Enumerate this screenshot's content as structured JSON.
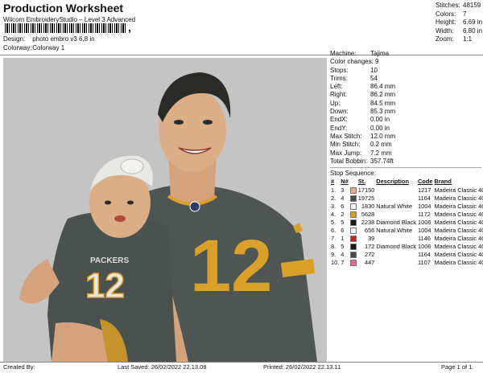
{
  "header": {
    "title": "Production Worksheet",
    "subtitle": "Wilcom EmbroideryStudio – Level 3 Advanced",
    "design_label": "Design:",
    "design_value": "photo embro v3 6,8 in",
    "colorway_label": "Colorway:",
    "colorway_value": "Colorway 1"
  },
  "stats": [
    {
      "label": "Stitches:",
      "value": "48159"
    },
    {
      "label": "Colors:",
      "value": "7"
    },
    {
      "label": "Height:",
      "value": "6.69 in"
    },
    {
      "label": "Width:",
      "value": "6.80 in"
    },
    {
      "label": "Zoom:",
      "value": "1:1"
    }
  ],
  "machine_info": [
    {
      "label": "Machine:",
      "value": "Tajima"
    },
    {
      "label": "Color changes:",
      "value": "9"
    },
    {
      "label": "Stops:",
      "value": "10"
    },
    {
      "label": "Trims:",
      "value": "54"
    },
    {
      "label": "Left:",
      "value": "86.4 mm"
    },
    {
      "label": "Right:",
      "value": "86.2 mm"
    },
    {
      "label": "Up:",
      "value": "84.5 mm"
    },
    {
      "label": "Down:",
      "value": "85.3 mm"
    },
    {
      "label": "EndX:",
      "value": "0.00 in"
    },
    {
      "label": "EndY:",
      "value": "0.00 in"
    },
    {
      "label": "Max Stitch:",
      "value": "12.0 mm"
    },
    {
      "label": "Min Stitch:",
      "value": "0.2 mm"
    },
    {
      "label": "Max Jump:",
      "value": "7.2 mm"
    },
    {
      "label": "Total Bobbin:",
      "value": "357.74ft"
    }
  ],
  "stop_sequence": {
    "title": "Stop Sequence:",
    "headers": [
      "#",
      "N#",
      "",
      "St.",
      "Description",
      "Code",
      "Brand"
    ],
    "rows": [
      {
        "num": "1.",
        "n": "3",
        "color": "#e8a98e",
        "st": "17150",
        "desc": "",
        "code": "1217",
        "brand": "Madeira Classic 40"
      },
      {
        "num": "2.",
        "n": "4",
        "color": "#4a4a4a",
        "st": "19725",
        "desc": "",
        "code": "1164",
        "brand": "Madeira Classic 40"
      },
      {
        "num": "3.",
        "n": "6",
        "color": "#f4f4f4",
        "st": "1830",
        "desc": "Natural White",
        "code": "1004",
        "brand": "Madeira Classic 40"
      },
      {
        "num": "4.",
        "n": "2",
        "color": "#d9a02a",
        "st": "5628",
        "desc": "",
        "code": "1172",
        "brand": "Madeira Classic 40"
      },
      {
        "num": "5.",
        "n": "5",
        "color": "#1a1a1a",
        "st": "2238",
        "desc": "Diamond Black",
        "code": "1006",
        "brand": "Madeira Classic 40"
      },
      {
        "num": "6.",
        "n": "6",
        "color": "#f4f4f4",
        "st": "656",
        "desc": "Natural White",
        "code": "1004",
        "brand": "Madeira Classic 40"
      },
      {
        "num": "7.",
        "n": "1",
        "color": "#c81e1e",
        "st": "39",
        "desc": "",
        "code": "1146",
        "brand": "Madeira Classic 40"
      },
      {
        "num": "8.",
        "n": "5",
        "color": "#1a1a1a",
        "st": "172",
        "desc": "Diamond Black",
        "code": "1006",
        "brand": "Madeira Classic 40"
      },
      {
        "num": "9.",
        "n": "4",
        "color": "#4a4a4a",
        "st": "272",
        "desc": "",
        "code": "1164",
        "brand": "Madeira Classic 40"
      },
      {
        "num": "10.",
        "n": "7",
        "color": "#e86a8a",
        "st": "447",
        "desc": "",
        "code": "1107",
        "brand": "Madeira Classic 40"
      }
    ]
  },
  "footer": {
    "created_by": "Created By:",
    "last_saved": "Last Saved: 26/02/2022 22.13.08",
    "printed": "Printed: 26/02/2022 22.13.11",
    "page": "Page 1 of 1"
  },
  "jersey_number": "12",
  "jersey_text": "PACKERS"
}
